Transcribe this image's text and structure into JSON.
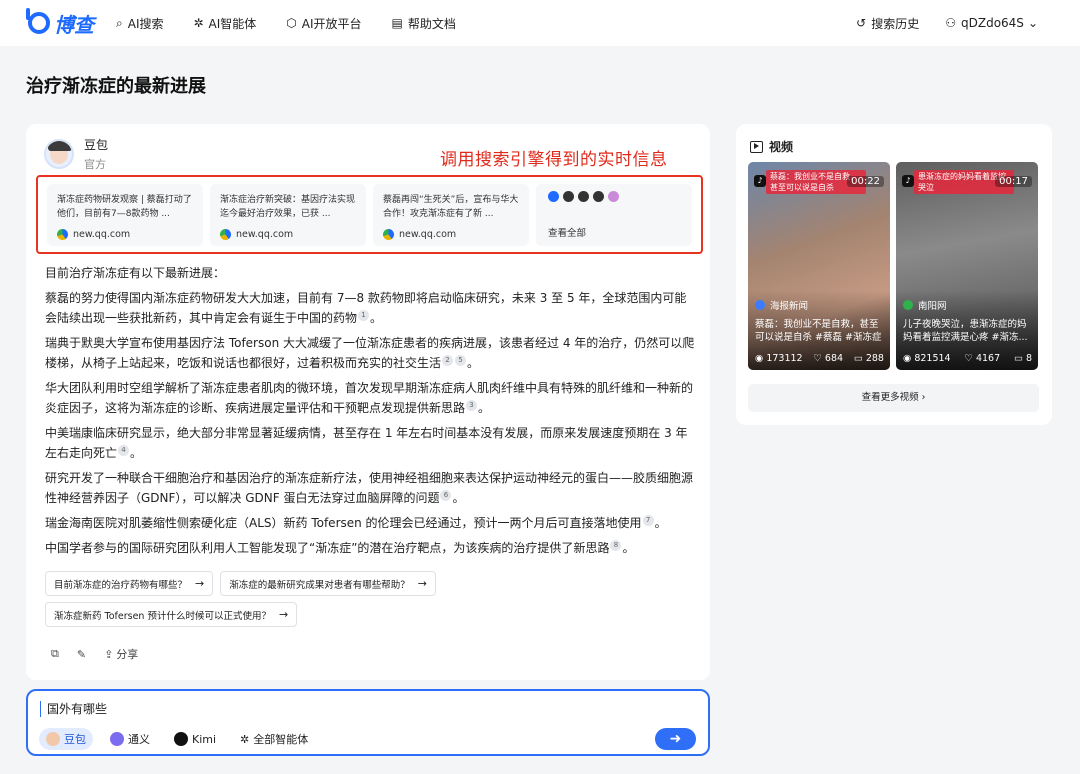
{
  "header": {
    "brand": "博查",
    "nav": [
      {
        "icon": "search-icon",
        "glyph": "⌕",
        "label": "AI搜索"
      },
      {
        "icon": "agent-icon",
        "glyph": "✲",
        "label": "AI智能体"
      },
      {
        "icon": "cube-icon",
        "glyph": "⬡",
        "label": "AI开放平台"
      },
      {
        "icon": "doc-icon",
        "glyph": "▤",
        "label": "帮助文档"
      }
    ],
    "history_label": "搜索历史",
    "history_glyph": "↺",
    "user_glyph": "⚇",
    "user_label": "qDZdo64S",
    "user_caret": "⌄"
  },
  "page_title": "治疗渐冻症的最新进展",
  "answer": {
    "agent_name": "豆包",
    "agent_sub": "官方",
    "annotation": "调用搜索引擎得到的实时信息",
    "references": [
      {
        "text": "渐冻症药物研发观察 | 蔡磊打动了他们，目前有7—8款药物 ...",
        "site": "new.qq.com"
      },
      {
        "text": "渐冻症治疗新突破：基因疗法实现迄今最好治疗效果，已获 ...",
        "site": "new.qq.com"
      },
      {
        "text": "蔡磊再闯“生死关”后，宣布与华大合作！攻克渐冻症有了新 ...",
        "site": "new.qq.com"
      }
    ],
    "view_all_label": "查看全部",
    "intro": "目前治疗渐冻症有以下最新进展：",
    "paragraphs": [
      {
        "text": "蔡磊的努力使得国内渐冻症药物研发大大加速，目前有 7—8 款药物即将启动临床研究，未来 3 至 5 年，全球范围内可能会陆续出现一些获批新药，其中肯定会有诞生于中国的药物",
        "cites": [
          "1"
        ],
        "end": "。"
      },
      {
        "text": "瑞典于默奥大学宣布使用基因疗法 Toferson 大大减缓了一位渐冻症患者的疾病进展，该患者经过 4 年的治疗，仍然可以爬楼梯，从椅子上站起来，吃饭和说话也都很好，过着积极而充实的社交生活",
        "cites": [
          "2",
          "5"
        ],
        "end": "。"
      },
      {
        "text": "华大团队利用时空组学解析了渐冻症患者肌肉的微环境，首次发现早期渐冻症病人肌肉纤维中具有特殊的肌纤维和一种新的炎症因子，这将为渐冻症的诊断、疾病进展定量评估和干预靶点发现提供新思路",
        "cites": [
          "3"
        ],
        "end": "。"
      },
      {
        "text": "中美瑞康临床研究显示，绝大部分非常显著延缓病情，甚至存在 1 年左右时间基本没有发展，而原来发展速度预期在 3 年左右走向死亡",
        "cites": [
          "4"
        ],
        "end": "。"
      },
      {
        "text": "研究开发了一种联合干细胞治疗和基因治疗的渐冻症新疗法，使用神经祖细胞来表达保护运动神经元的蛋白——胶质细胞源性神经营养因子（GDNF），可以解决 GDNF 蛋白无法穿过血脑屏障的问题",
        "cites": [
          "6"
        ],
        "end": "。"
      },
      {
        "text": "瑞金海南医院对肌萎缩性侧索硬化症（ALS）新药 Tofersen 的伦理会已经通过，预计一两个月后可直接落地使用",
        "cites": [
          "7"
        ],
        "end": "。"
      },
      {
        "text": "中国学者参与的国际研究团队利用人工智能发现了“渐冻症”的潜在治疗靶点，为该疾病的治疗提供了新思路",
        "cites": [
          "8"
        ],
        "end": "。"
      }
    ],
    "suggestions": [
      "目前渐冻症的治疗药物有哪些？",
      "渐冻症的最新研究成果对患者有哪些帮助？",
      "渐冻症新药 Tofersen 预计什么时候可以正式使用？"
    ],
    "suggestion_arrow": "→",
    "actions": {
      "copy_glyph": "⧉",
      "edit_glyph": "✎",
      "share_glyph": "⇪",
      "share_label": "分享"
    }
  },
  "input": {
    "value": "国外有哪些",
    "agents": [
      {
        "label": "豆包",
        "active": true,
        "color": "#f2c8a8"
      },
      {
        "label": "通义",
        "active": false,
        "color": "#7b6cf0"
      },
      {
        "label": "Kimi",
        "active": false,
        "color": "#111111"
      }
    ],
    "all_agents_glyph": "✲",
    "all_agents_label": "全部智能体",
    "send_glyph": "➜"
  },
  "side": {
    "title": "视频",
    "videos": [
      {
        "headline": "蔡磊：我创业不是自救，甚至可以说是自杀",
        "duration": "00:22",
        "source": "海报新闻",
        "caption": "蔡磊：我创业不是自救，甚至可以说是自杀 #蔡磊 #渐冻症",
        "views": "173112",
        "likes": "684",
        "comments": "288"
      },
      {
        "headline": "患渐冻症的妈妈看着监控哭泣",
        "duration": "00:17",
        "source": "南阳网",
        "caption": "儿子夜晚哭泣，患渐冻症的妈妈看着监控满是心疼 #渐冻...",
        "views": "821514",
        "likes": "4167",
        "comments": "8"
      }
    ],
    "more_label": "查看更多视频 ›",
    "stat_glyphs": {
      "views": "◉",
      "likes": "♡",
      "comments": "▭"
    }
  }
}
